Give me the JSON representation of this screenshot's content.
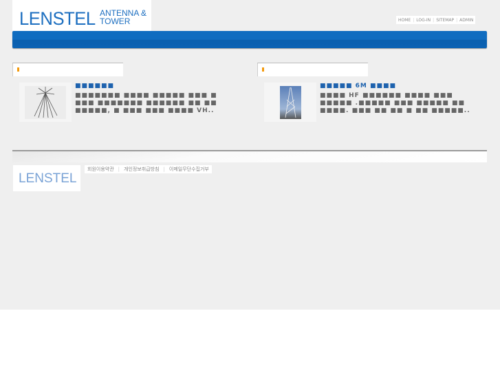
{
  "header": {
    "logo_brand": "LENSTEL",
    "logo_sub": "ANTENNA & TOWER",
    "nav": [
      "HOME",
      "LOG-IN",
      "SITEMAP",
      "ADMIN"
    ]
  },
  "products": [
    {
      "title": "■■■■■■",
      "desc": "■■■■■■■ ■■■■ ■■■■■ ■■■ ■ ■■■ ■■■■■■■ ■■■■■■ ■■ ■■ ■■■■■, ■ ■■■ ■■■ ■■■■ VH..",
      "image": "antenna-image"
    },
    {
      "title": "■■■■■ 6M ■■■■",
      "desc": "■■■■ HF ■■■■■■ ■■■■ ■■■ ■■■■■ .■■■■■ ■■■ ■■■■■ ■■ ■■■■. ■■■ ■■ ■■ ■ ■■ ■■■■■..",
      "image": "tower-image"
    }
  ],
  "footer": {
    "logo": "LENSTEL",
    "links": [
      "회원이용약관",
      "개인정보취급방침",
      "이메일무단수집거부"
    ]
  },
  "colors": {
    "brand": "#1d6fc0",
    "accent": "#f39a0d"
  }
}
